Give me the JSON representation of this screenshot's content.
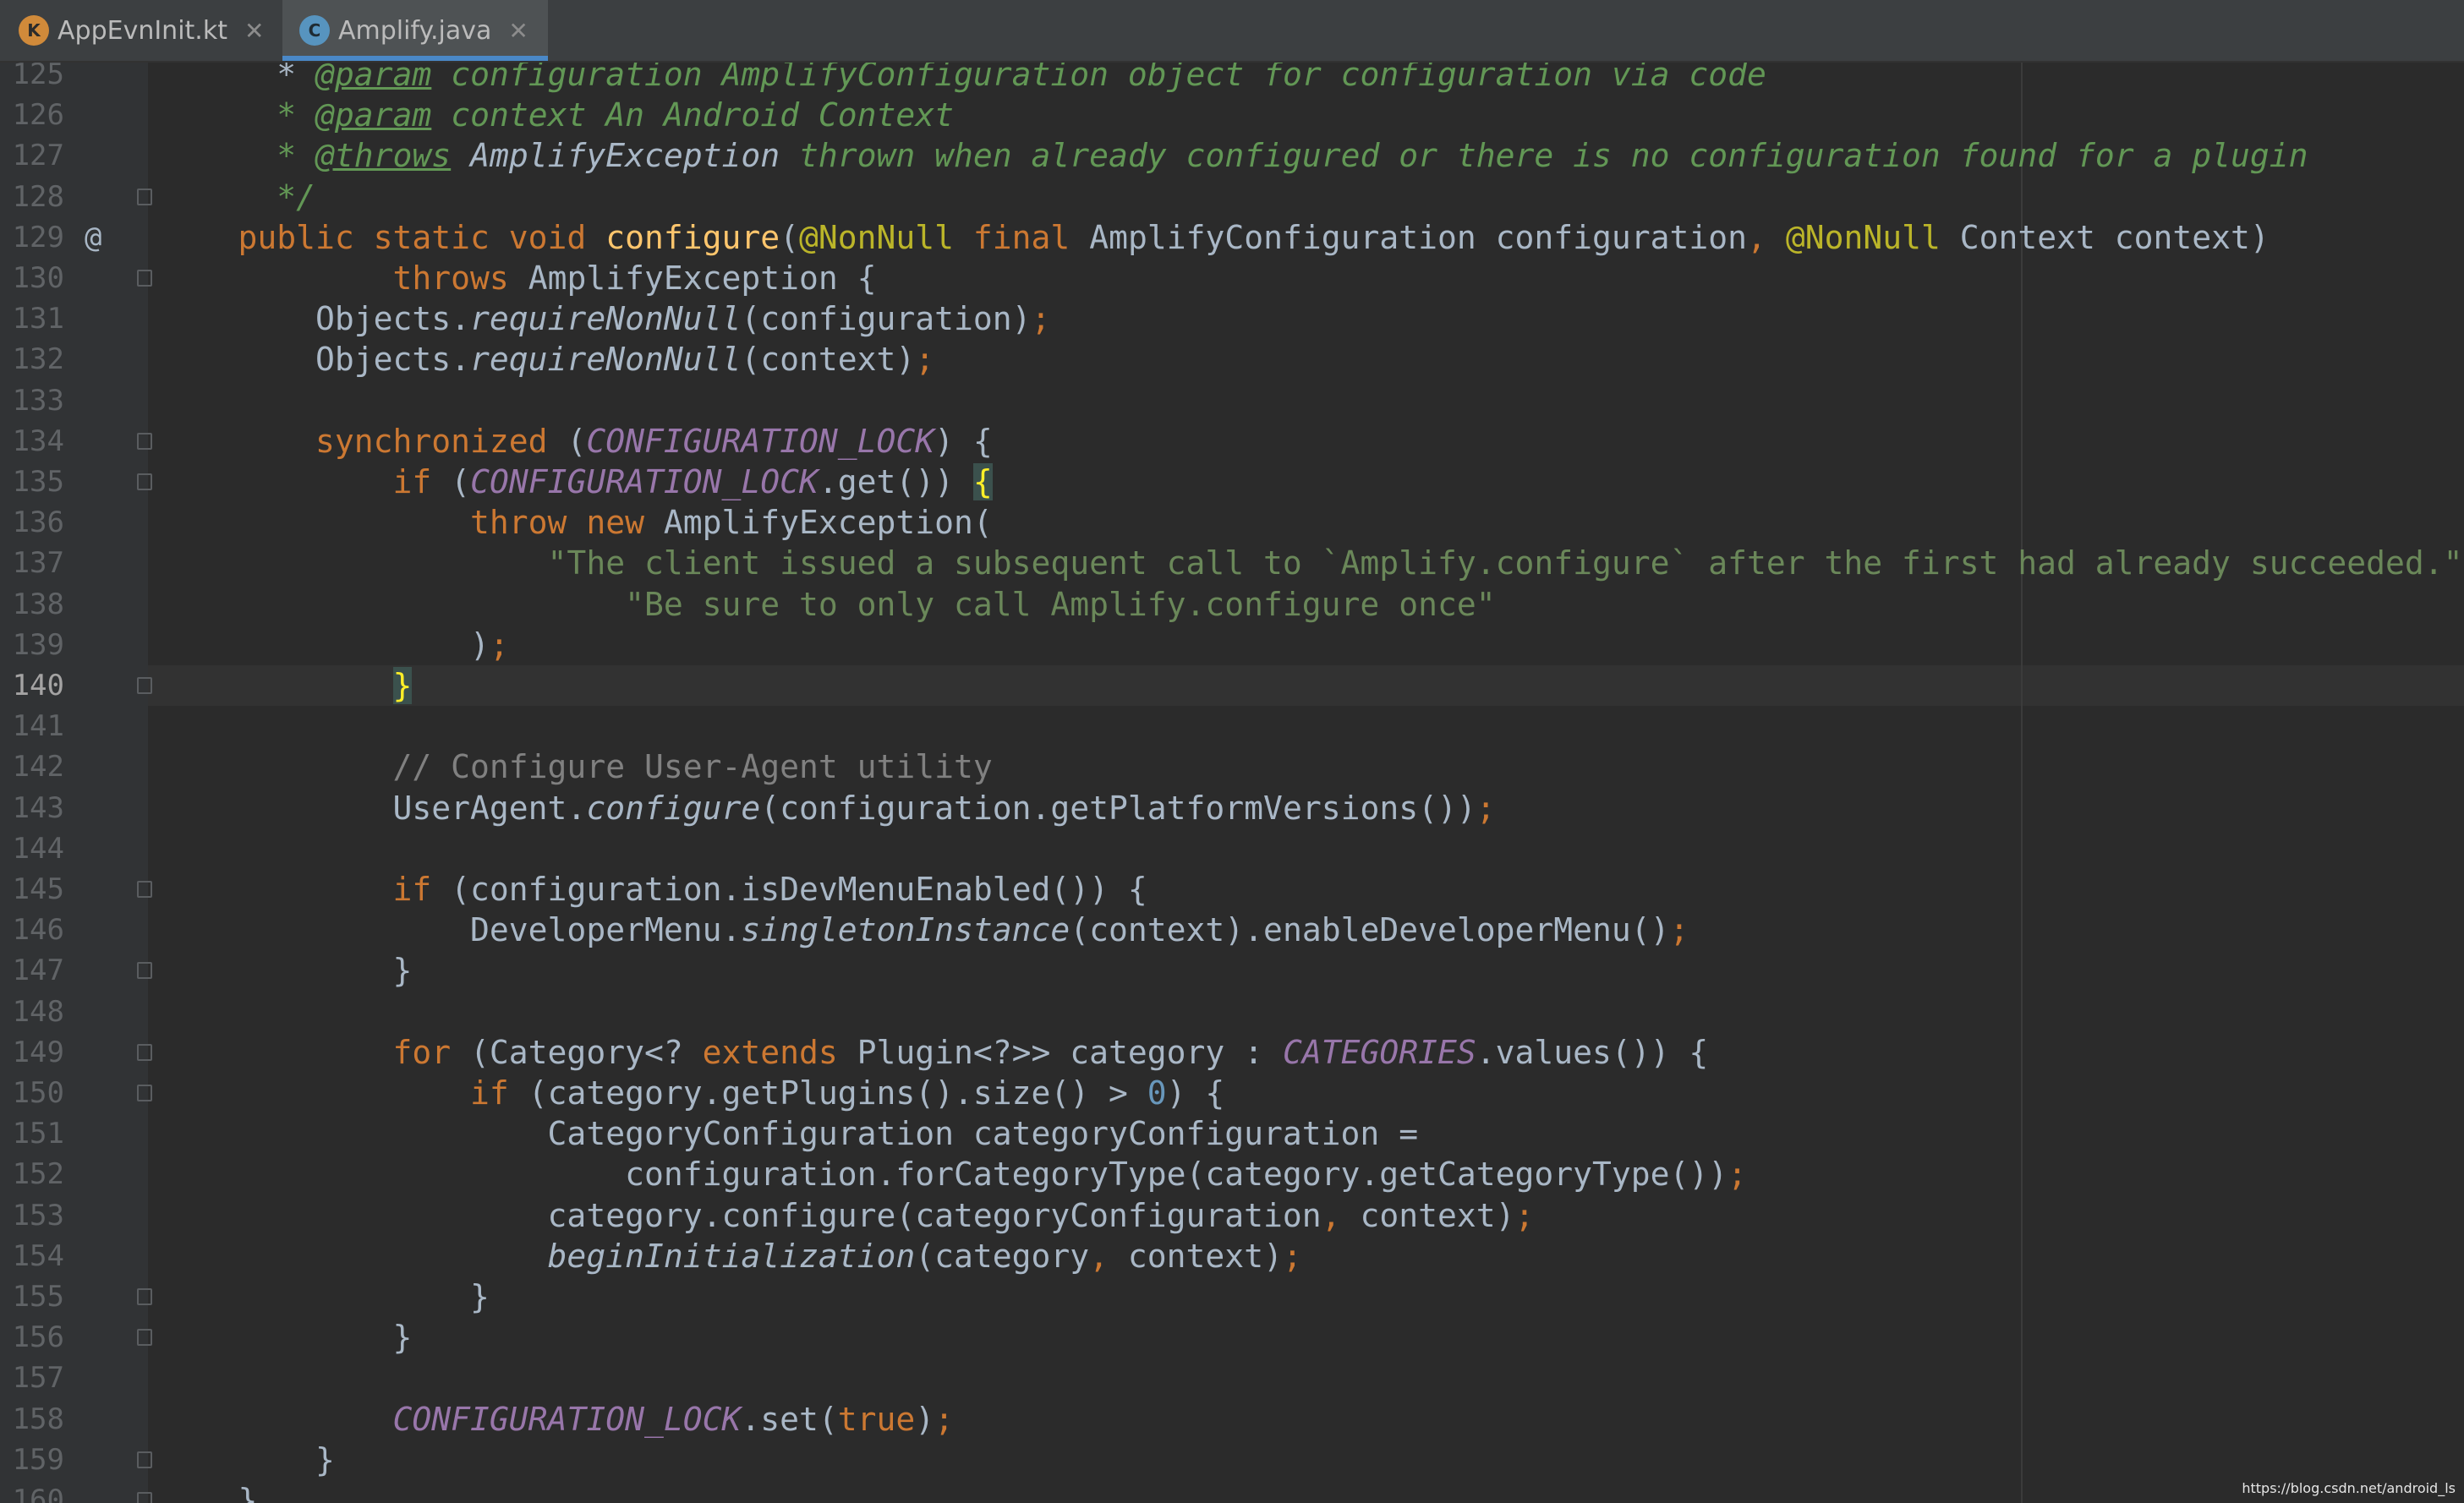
{
  "colors": {
    "background": "#2b2b2b",
    "gutter": "#313335",
    "keyword": "#cc7832",
    "string": "#6a8759",
    "constant": "#9876aa",
    "annotation": "#bbb529",
    "method_decl": "#ffc66d",
    "comment": "#808080",
    "doc_comment": "#629755",
    "number": "#6897bb",
    "tab_accent": "#4a88c7"
  },
  "tabs": [
    {
      "label": "AppEvnInit.kt",
      "icon": "kotlin-file-icon",
      "active": false
    },
    {
      "label": "Amplify.java",
      "icon": "java-class-icon",
      "active": true
    }
  ],
  "watermark": "https://blog.csdn.net/android_ls",
  "editor": {
    "current_line": 140,
    "lines": [
      {
        "n": "125",
        "fold": false,
        "mark": "",
        "tokens": [
          [
            "",
            "      * "
          ],
          [
            "dtag",
            "@param"
          ],
          [
            "doc",
            " configuration AmplifyConfiguration object for configuration via code"
          ]
        ]
      },
      {
        "n": "126",
        "fold": false,
        "mark": "",
        "tokens": [
          [
            "doc",
            "      * "
          ],
          [
            "dtag",
            "@param"
          ],
          [
            "doc",
            " context An Android Context"
          ]
        ]
      },
      {
        "n": "127",
        "fold": false,
        "mark": "",
        "tokens": [
          [
            "doc",
            "      * "
          ],
          [
            "dtag",
            "@throws"
          ],
          [
            "dref",
            " AmplifyException"
          ],
          [
            "doc",
            " thrown when already configured or there is no configuration found for a plugin"
          ]
        ]
      },
      {
        "n": "128",
        "fold": true,
        "mark": "",
        "tokens": [
          [
            "doc",
            "      */"
          ]
        ]
      },
      {
        "n": "129",
        "fold": false,
        "mark": "@",
        "tokens": [
          [
            "kw",
            "    public static void "
          ],
          [
            "fn",
            "configure"
          ],
          [
            "",
            "("
          ],
          [
            "ann",
            "@NonNull "
          ],
          [
            "kw",
            "final "
          ],
          [
            "",
            "AmplifyConfiguration configuration"
          ],
          [
            "kw",
            ", "
          ],
          [
            "ann",
            "@NonNull "
          ],
          [
            "",
            "Context context)"
          ]
        ]
      },
      {
        "n": "130",
        "fold": true,
        "mark": "",
        "tokens": [
          [
            "kw",
            "            throws "
          ],
          [
            "",
            "AmplifyException {"
          ]
        ]
      },
      {
        "n": "131",
        "fold": false,
        "mark": "",
        "tokens": [
          [
            "",
            "        Objects."
          ],
          [
            "ital",
            "requireNonNull"
          ],
          [
            "",
            "(configuration)"
          ],
          [
            "kw",
            ";"
          ]
        ]
      },
      {
        "n": "132",
        "fold": false,
        "mark": "",
        "tokens": [
          [
            "",
            "        Objects."
          ],
          [
            "ital",
            "requireNonNull"
          ],
          [
            "",
            "(context)"
          ],
          [
            "kw",
            ";"
          ]
        ]
      },
      {
        "n": "133",
        "fold": false,
        "mark": "",
        "tokens": [
          [
            "",
            ""
          ]
        ]
      },
      {
        "n": "134",
        "fold": true,
        "mark": "",
        "tokens": [
          [
            "kw",
            "        synchronized "
          ],
          [
            "",
            "("
          ],
          [
            "const",
            "CONFIGURATION_LOCK"
          ],
          [
            "",
            ") {"
          ]
        ]
      },
      {
        "n": "135",
        "fold": true,
        "mark": "",
        "tokens": [
          [
            "kw",
            "            if "
          ],
          [
            "",
            "("
          ],
          [
            "const",
            "CONFIGURATION_LOCK"
          ],
          [
            "",
            ".get()) "
          ],
          [
            "brace-hl",
            "{"
          ]
        ]
      },
      {
        "n": "136",
        "fold": false,
        "mark": "",
        "tokens": [
          [
            "kw",
            "                throw new "
          ],
          [
            "",
            "AmplifyException("
          ]
        ]
      },
      {
        "n": "137",
        "fold": false,
        "mark": "",
        "tokens": [
          [
            "str",
            "                    \"The client issued a subsequent call to `Amplify.configure` after the first had already succeeded.\""
          ],
          [
            "kw",
            ","
          ]
        ]
      },
      {
        "n": "138",
        "fold": false,
        "mark": "",
        "tokens": [
          [
            "str",
            "                        \"Be sure to only call Amplify.configure once\""
          ]
        ]
      },
      {
        "n": "139",
        "fold": false,
        "mark": "",
        "tokens": [
          [
            "",
            "                )"
          ],
          [
            "kw",
            ";"
          ]
        ]
      },
      {
        "n": "140",
        "fold": true,
        "mark": "",
        "tokens": [
          [
            "",
            "            "
          ],
          [
            "brace-hl",
            "}"
          ]
        ]
      },
      {
        "n": "141",
        "fold": false,
        "mark": "",
        "tokens": [
          [
            "",
            ""
          ]
        ]
      },
      {
        "n": "142",
        "fold": false,
        "mark": "",
        "tokens": [
          [
            "cmt",
            "            // Configure User-Agent utility"
          ]
        ]
      },
      {
        "n": "143",
        "fold": false,
        "mark": "",
        "tokens": [
          [
            "",
            "            UserAgent."
          ],
          [
            "ital",
            "configure"
          ],
          [
            "",
            "(configuration.getPlatformVersions())"
          ],
          [
            "kw",
            ";"
          ]
        ]
      },
      {
        "n": "144",
        "fold": false,
        "mark": "",
        "tokens": [
          [
            "",
            ""
          ]
        ]
      },
      {
        "n": "145",
        "fold": true,
        "mark": "",
        "tokens": [
          [
            "kw",
            "            if "
          ],
          [
            "",
            "(configuration.isDevMenuEnabled()) {"
          ]
        ]
      },
      {
        "n": "146",
        "fold": false,
        "mark": "",
        "tokens": [
          [
            "",
            "                DeveloperMenu."
          ],
          [
            "ital",
            "singletonInstance"
          ],
          [
            "",
            "(context).enableDeveloperMenu()"
          ],
          [
            "kw",
            ";"
          ]
        ]
      },
      {
        "n": "147",
        "fold": true,
        "mark": "",
        "tokens": [
          [
            "",
            "            }"
          ]
        ]
      },
      {
        "n": "148",
        "fold": false,
        "mark": "",
        "tokens": [
          [
            "",
            ""
          ]
        ]
      },
      {
        "n": "149",
        "fold": true,
        "mark": "",
        "tokens": [
          [
            "kw",
            "            for "
          ],
          [
            "",
            "(Category<? "
          ],
          [
            "kw",
            "extends "
          ],
          [
            "",
            "Plugin<?>> category : "
          ],
          [
            "const",
            "CATEGORIES"
          ],
          [
            "",
            ".values()) {"
          ]
        ]
      },
      {
        "n": "150",
        "fold": true,
        "mark": "",
        "tokens": [
          [
            "kw",
            "                if "
          ],
          [
            "",
            "(category.getPlugins().size() > "
          ],
          [
            "num",
            "0"
          ],
          [
            "",
            ") {"
          ]
        ]
      },
      {
        "n": "151",
        "fold": false,
        "mark": "",
        "tokens": [
          [
            "",
            "                    CategoryConfiguration categoryConfiguration ="
          ]
        ]
      },
      {
        "n": "152",
        "fold": false,
        "mark": "",
        "tokens": [
          [
            "",
            "                        configuration.forCategoryType(category.getCategoryType())"
          ],
          [
            "kw",
            ";"
          ]
        ]
      },
      {
        "n": "153",
        "fold": false,
        "mark": "",
        "tokens": [
          [
            "",
            "                    category.configure(categoryConfiguration"
          ],
          [
            "kw",
            ", "
          ],
          [
            "",
            "context)"
          ],
          [
            "kw",
            ";"
          ]
        ]
      },
      {
        "n": "154",
        "fold": false,
        "mark": "",
        "tokens": [
          [
            "ital",
            "                    beginInitialization"
          ],
          [
            "",
            "(category"
          ],
          [
            "kw",
            ", "
          ],
          [
            "",
            "context)"
          ],
          [
            "kw",
            ";"
          ]
        ]
      },
      {
        "n": "155",
        "fold": true,
        "mark": "",
        "tokens": [
          [
            "",
            "                }"
          ]
        ]
      },
      {
        "n": "156",
        "fold": true,
        "mark": "",
        "tokens": [
          [
            "",
            "            }"
          ]
        ]
      },
      {
        "n": "157",
        "fold": false,
        "mark": "",
        "tokens": [
          [
            "",
            ""
          ]
        ]
      },
      {
        "n": "158",
        "fold": false,
        "mark": "",
        "tokens": [
          [
            "const",
            "            CONFIGURATION_LOCK"
          ],
          [
            "",
            ".set("
          ],
          [
            "kw",
            "true"
          ],
          [
            "",
            ")"
          ],
          [
            "kw",
            ";"
          ]
        ]
      },
      {
        "n": "159",
        "fold": true,
        "mark": "",
        "tokens": [
          [
            "",
            "        }"
          ]
        ]
      },
      {
        "n": "160",
        "fold": true,
        "mark": "",
        "tokens": [
          [
            "",
            "    }"
          ]
        ]
      }
    ]
  }
}
